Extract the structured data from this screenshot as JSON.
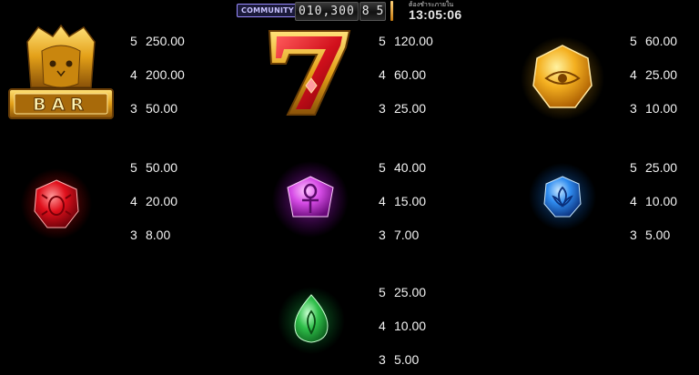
{
  "topbar": {
    "community_label": "COMMUNITY",
    "counter_main": "010,300",
    "counter_decimal": "8 5",
    "clock_label": "ต้องชำระภายใน",
    "clock_time": "13:05:06"
  },
  "paytable": [
    {
      "symbol": "bar-pharaoh-cat",
      "symbol_text": "BAR",
      "pays": [
        {
          "count": "5",
          "amount": "250.00"
        },
        {
          "count": "4",
          "amount": "200.00"
        },
        {
          "count": "3",
          "amount": "50.00"
        }
      ]
    },
    {
      "symbol": "red-seven",
      "pays": [
        {
          "count": "5",
          "amount": "120.00"
        },
        {
          "count": "4",
          "amount": "60.00"
        },
        {
          "count": "3",
          "amount": "25.00"
        }
      ]
    },
    {
      "symbol": "gold-eye-gem",
      "pays": [
        {
          "count": "5",
          "amount": "60.00"
        },
        {
          "count": "4",
          "amount": "25.00"
        },
        {
          "count": "3",
          "amount": "10.00"
        }
      ]
    },
    {
      "symbol": "red-scarab-gem",
      "pays": [
        {
          "count": "5",
          "amount": "50.00"
        },
        {
          "count": "4",
          "amount": "20.00"
        },
        {
          "count": "3",
          "amount": "8.00"
        }
      ]
    },
    {
      "symbol": "purple-ankh-gem",
      "pays": [
        {
          "count": "5",
          "amount": "40.00"
        },
        {
          "count": "4",
          "amount": "15.00"
        },
        {
          "count": "3",
          "amount": "7.00"
        }
      ]
    },
    {
      "symbol": "blue-lotus-gem",
      "pays": [
        {
          "count": "5",
          "amount": "25.00"
        },
        {
          "count": "4",
          "amount": "10.00"
        },
        {
          "count": "3",
          "amount": "5.00"
        }
      ]
    },
    {
      "symbol": "green-drop-gem",
      "pays": [
        {
          "count": "5",
          "amount": "25.00"
        },
        {
          "count": "4",
          "amount": "10.00"
        },
        {
          "count": "3",
          "amount": "5.00"
        }
      ]
    }
  ],
  "colors": {
    "gold": "#f0b42a",
    "red": "#e21b2a",
    "purple": "#d64ce6",
    "blue": "#2f8cf0",
    "green": "#2fbf4a"
  }
}
